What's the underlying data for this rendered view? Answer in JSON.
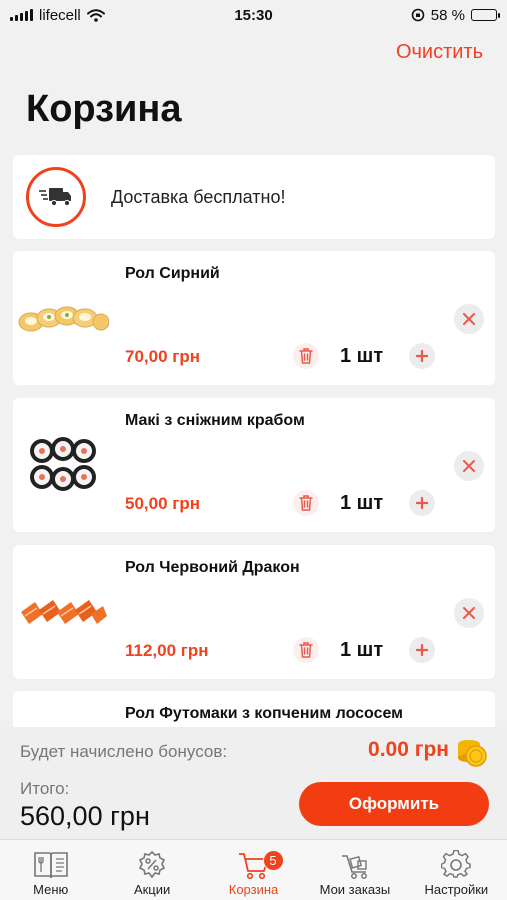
{
  "status_bar": {
    "carrier": "lifecell",
    "time": "15:30",
    "battery": "58 %",
    "battery_level": 0.58
  },
  "header": {
    "clear_label": "Очистить",
    "title": "Корзина"
  },
  "delivery": {
    "text": "Доставка бесплатно!",
    "icon": "delivery-truck-icon"
  },
  "cart_items": [
    {
      "name": "Рол Сирний",
      "price": "70,00 грн",
      "quantity": "1 шт"
    },
    {
      "name": "Макі з сніжним крабом",
      "price": "50,00 грн",
      "quantity": "1 шт"
    },
    {
      "name": "Рол Червоний Дракон",
      "price": "112,00 грн",
      "quantity": "1 шт"
    },
    {
      "name": "Рол Футомаки з копченим лососем"
    }
  ],
  "summary": {
    "bonus_label": "Будет начислено бонусов:",
    "bonus_value": "0.00 грн",
    "total_label": "Итого:",
    "total_value": "560,00 грн",
    "checkout_label": "Оформить"
  },
  "tabbar": {
    "tabs": [
      {
        "label": "Меню",
        "icon": "menu-book-icon"
      },
      {
        "label": "Акции",
        "icon": "discount-icon"
      },
      {
        "label": "Корзина",
        "icon": "cart-icon",
        "badge": "5",
        "active": true
      },
      {
        "label": "Мои заказы",
        "icon": "orders-cart-icon"
      },
      {
        "label": "Настройки",
        "icon": "gear-icon"
      }
    ]
  },
  "colors": {
    "accent": "#f0421f",
    "background": "#f1f1f1",
    "card": "#ffffff"
  }
}
